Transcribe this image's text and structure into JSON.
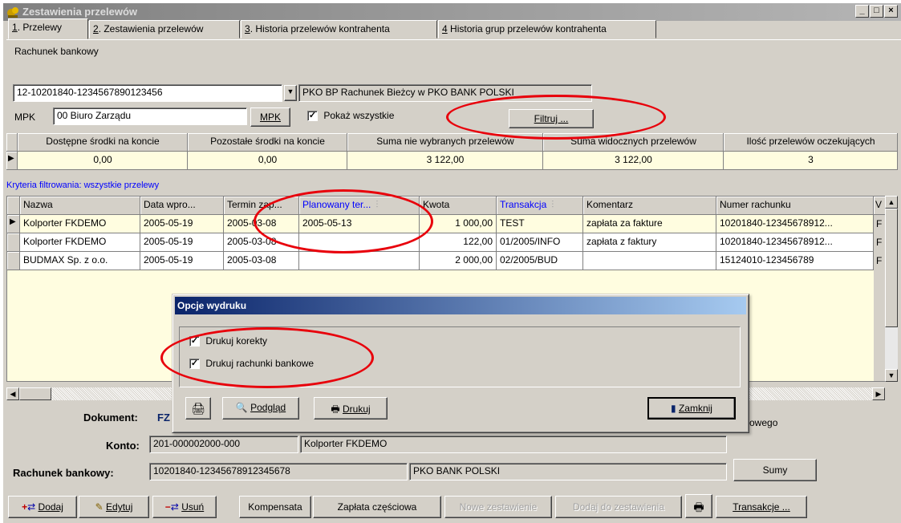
{
  "window": {
    "title": "Zestawienia przelewów",
    "min": "_",
    "max": "□",
    "close": "×"
  },
  "tabs": [
    {
      "num": "1",
      "label": ". Przelewy"
    },
    {
      "num": "2",
      "label": ". Zestawienia przelewów"
    },
    {
      "num": "3",
      "label": ". Historia przelewów kontrahenta"
    },
    {
      "num": "4",
      "label": " Historia grup przelewów kontrahenta"
    }
  ],
  "account": {
    "label": "Rachunek bankowy",
    "number": "12-10201840-1234567890123456",
    "bank": "PKO BP Rachunek Bieżcy  w PKO BANK POLSKI"
  },
  "mpk": {
    "label": "MPK",
    "value": "00  Biuro Zarządu",
    "button": "MPK",
    "show_all": "Pokaż wszystkie",
    "filter_button": "Filtruj ..."
  },
  "summary": {
    "headers": [
      "Dostępne środki na koncie",
      "Pozostałe środki na koncie",
      "Suma nie wybranych przelewów",
      "Suma widocznych przelewów",
      "Ilość przelewów oczekujących"
    ],
    "values": [
      "0,00",
      "0,00",
      "3 122,00",
      "3 122,00",
      "3"
    ]
  },
  "filter_criteria": "Kryteria filtrowania: wszystkie przelewy",
  "transfers": {
    "headers": [
      "Nazwa",
      "Data wpro...",
      "Termin zap...",
      "Planowany ter...",
      "Kwota",
      "Transakcja",
      "Komentarz",
      "Numer rachunku",
      "V"
    ],
    "rows": [
      [
        "Kolporter FKDEMO",
        "2005-05-19",
        "2005-03-08",
        "2005-05-13",
        "1 000,00",
        "TEST",
        "zapłata za fakture",
        "10201840-12345678912...",
        "F"
      ],
      [
        "Kolporter FKDEMO",
        "2005-05-19",
        "2005-03-08",
        "",
        "122,00",
        "01/2005/INFO",
        "zapłata z faktury",
        "10201840-12345678912...",
        "F"
      ],
      [
        "BUDMAX Sp. z o.o.",
        "2005-05-19",
        "2005-03-08",
        "",
        "2 000,00",
        "02/2005/BUD",
        "",
        "15124010-123456789",
        "F"
      ]
    ]
  },
  "details": {
    "document_label": "Dokument:",
    "document_value": "FZ",
    "document_suffix": "owego",
    "konto_label": "Konto:",
    "konto_value": "201-000002000-000",
    "konto_name": "Kolporter FKDEMO",
    "bank_label": "Rachunek bankowy:",
    "bank_number": "10201840-12345678912345678",
    "bank_name": "PKO BANK POLSKI",
    "sums_button": "Sumy"
  },
  "toolbar": {
    "add": "Dodaj",
    "edit": "Edytuj",
    "delete": "Usuń",
    "compensate": "Kompensata",
    "partial": "Zapłata częściowa",
    "new_statement": "Nowe zestawienie",
    "add_to_statement": "Dodaj do zestawienia",
    "transactions": "Transakcje ..."
  },
  "dialog": {
    "title": "Opcje wydruku",
    "options": [
      "Drukuj korekty",
      "Drukuj rachunki bankowe"
    ],
    "checked": [
      "✓",
      "✓"
    ],
    "preview": "Podgląd",
    "print": "Drukuj",
    "close": "Zamknij"
  },
  "colors": {
    "highlight": "#e8000b",
    "title_active": "#0a246a",
    "selected_row": "#fffde0",
    "link_blue": "#0000ff"
  }
}
